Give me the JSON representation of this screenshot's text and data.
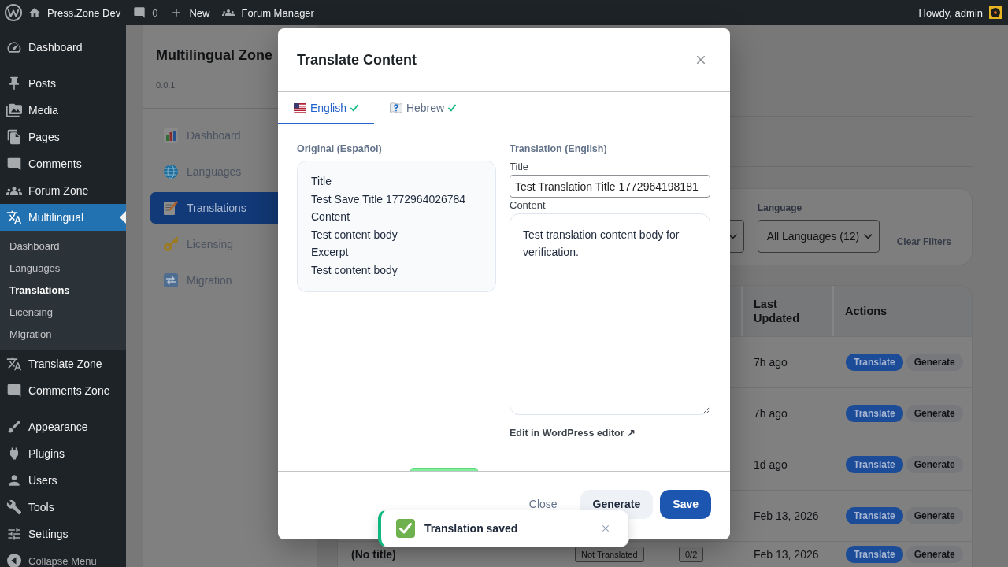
{
  "admin_bar": {
    "site_name": "Press.Zone Dev",
    "comment_count": "0",
    "new_label": "New",
    "forum_label": "Forum Manager",
    "greeting": "Howdy, admin"
  },
  "admin_menu": {
    "groups": [
      {
        "items": [
          {
            "label": "Dashboard",
            "selected": false
          }
        ]
      },
      {
        "items": [
          {
            "label": "Posts",
            "selected": false
          },
          {
            "label": "Media",
            "selected": false
          },
          {
            "label": "Pages",
            "selected": false
          },
          {
            "label": "Comments",
            "selected": false
          },
          {
            "label": "Forum Zone",
            "selected": false
          },
          {
            "label": "Multilingual",
            "selected": true,
            "children": [
              {
                "label": "Dashboard",
                "selected": false
              },
              {
                "label": "Languages",
                "selected": false
              },
              {
                "label": "Translations",
                "selected": true
              },
              {
                "label": "Licensing",
                "selected": false
              },
              {
                "label": "Migration",
                "selected": false
              }
            ]
          },
          {
            "label": "Translate Zone",
            "selected": false
          },
          {
            "label": "Comments Zone",
            "selected": false
          }
        ]
      },
      {
        "items": [
          {
            "label": "Appearance",
            "selected": false
          },
          {
            "label": "Plugins",
            "selected": false
          },
          {
            "label": "Users",
            "selected": false
          },
          {
            "label": "Tools",
            "selected": false
          },
          {
            "label": "Settings",
            "selected": false
          }
        ]
      }
    ],
    "collapse_label": "Collapse Menu"
  },
  "plugin": {
    "title": "Multilingual Zone",
    "version": "0.0.1",
    "nav": [
      {
        "label": "Dashboard",
        "selected": false
      },
      {
        "label": "Languages",
        "selected": false
      },
      {
        "label": "Translations",
        "selected": true
      },
      {
        "label": "Licensing",
        "selected": false
      },
      {
        "label": "Migration",
        "selected": false
      }
    ]
  },
  "filters": {
    "language_label": "Language",
    "language_value": "All Languages (12)",
    "clear_label": "Clear Filters"
  },
  "table": {
    "columns": [
      {
        "label": "Last Updated"
      },
      {
        "label": "Actions"
      }
    ],
    "rows": [
      {
        "updated": "7h ago",
        "actions": [
          {
            "label": "Translate",
            "kind": "primary"
          },
          {
            "label": "Generate",
            "kind": "secondary"
          }
        ]
      },
      {
        "updated": "7h ago",
        "actions": [
          {
            "label": "Translate",
            "kind": "primary"
          },
          {
            "label": "Generate",
            "kind": "secondary"
          }
        ]
      },
      {
        "updated": "1d ago",
        "actions": [
          {
            "label": "Translate",
            "kind": "primary"
          },
          {
            "label": "Generate",
            "kind": "secondary"
          }
        ]
      },
      {
        "updated": "Feb 13, 2026",
        "actions": [
          {
            "label": "Translate",
            "kind": "primary"
          },
          {
            "label": "Generate",
            "kind": "secondary"
          }
        ]
      },
      {
        "title": "(No title)",
        "status": "Not Translated",
        "progress": "0/2",
        "updated": "Feb 13, 2026",
        "actions": [
          {
            "label": "Translate",
            "kind": "primary"
          },
          {
            "label": "Generate",
            "kind": "secondary"
          }
        ]
      }
    ]
  },
  "modal": {
    "title": "Translate Content",
    "tabs": [
      {
        "label": "English",
        "selected": true,
        "complete": true
      },
      {
        "label": "Hebrew",
        "selected": false,
        "complete": true
      }
    ],
    "original": {
      "label": "Original (Español)",
      "lines": [
        "Title",
        "Test Save Title 1772964026784",
        "Content",
        "Test content body",
        "Excerpt",
        "Test content body"
      ]
    },
    "translation": {
      "label": "Translation (English)",
      "title_label": "Title",
      "title_value": "Test Translation Title 1772964198181",
      "content_label": "Content",
      "content_value": "Test translation content body for verification.",
      "editor_link": "Edit in WordPress editor ↗"
    },
    "buttons": [
      {
        "label": "Close",
        "kind": "text"
      },
      {
        "label": "Generate",
        "kind": "secondary"
      },
      {
        "label": "Save",
        "kind": "primary"
      }
    ]
  },
  "toast": {
    "message": "Translation saved"
  }
}
